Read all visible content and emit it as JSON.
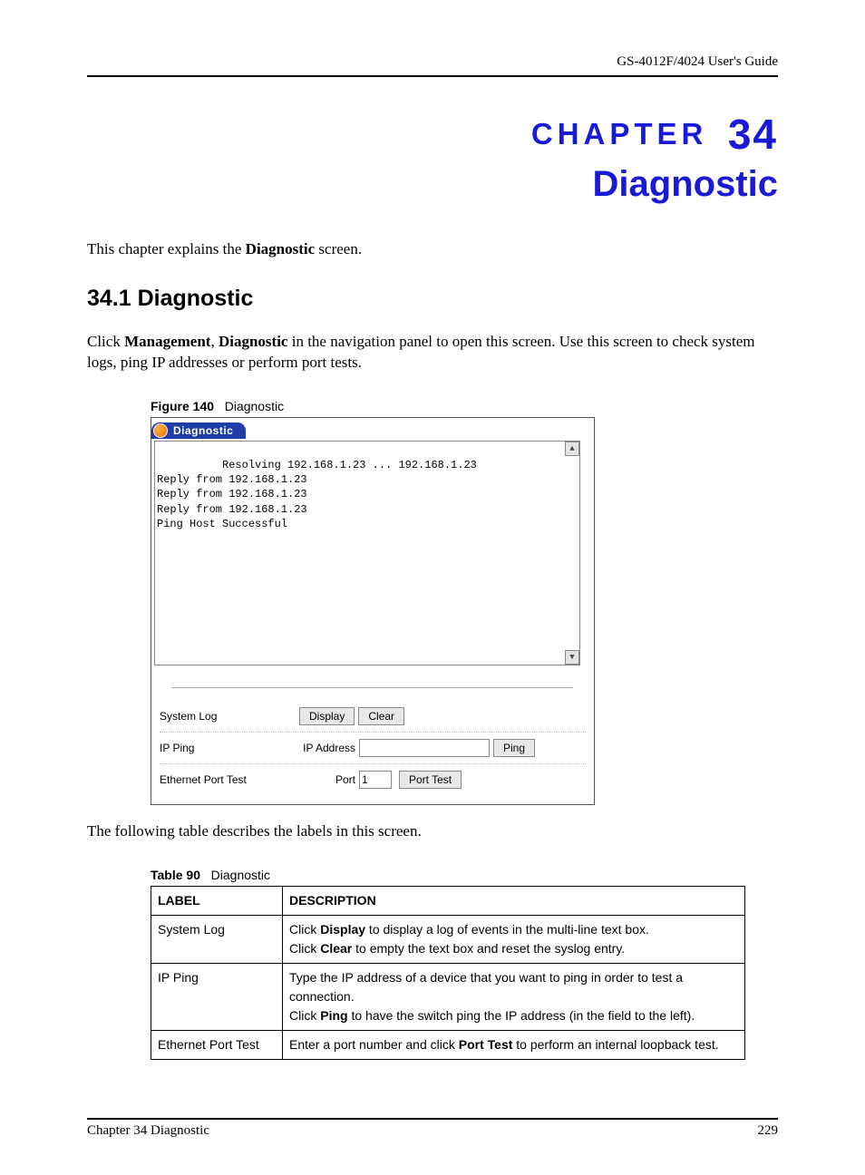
{
  "header": {
    "guide": "GS-4012F/4024 User's Guide"
  },
  "chapter": {
    "word": "CHAPTER",
    "number": "34",
    "title": "Diagnostic",
    "intro_pre": "This chapter explains the ",
    "intro_bold": "Diagnostic",
    "intro_post": " screen."
  },
  "section": {
    "heading": "34.1  Diagnostic",
    "para_pre": "Click ",
    "b1": "Management",
    "sep": ", ",
    "b2": "Diagnostic",
    "para_post": " in the navigation panel to open this screen. Use this screen to check system logs, ping IP addresses or perform port tests."
  },
  "figure": {
    "caption_label": "Figure 140",
    "caption_text": "Diagnostic",
    "tab_label": "Diagnostic",
    "log": "Resolving 192.168.1.23 ... 192.168.1.23\nReply from 192.168.1.23\nReply from 192.168.1.23\nReply from 192.168.1.23\nPing Host Successful",
    "rows": {
      "syslog": {
        "label": "System Log",
        "display": "Display",
        "clear": "Clear"
      },
      "ipping": {
        "label": "IP Ping",
        "sub": "IP Address",
        "value": "",
        "ping": "Ping"
      },
      "porttest": {
        "label": "Ethernet Port Test",
        "sub": "Port",
        "value": "1",
        "btn": "Port Test"
      }
    }
  },
  "after_figure": "The following table describes the labels in this screen.",
  "table": {
    "caption_label": "Table 90",
    "caption_text": "Diagnostic",
    "head": {
      "label": "LABEL",
      "desc": "DESCRIPTION"
    },
    "rows": [
      {
        "label": "System Log",
        "d1_pre": "Click ",
        "d1_b": "Display",
        "d1_post": " to display a log of events in the multi-line text box.",
        "d2_pre": "Click ",
        "d2_b": "Clear",
        "d2_post": " to empty the text box and reset the syslog entry."
      },
      {
        "label": "IP Ping",
        "d1_pre": "Type the IP address of a device that you want to ping in order to test a connection.",
        "d1_b": "",
        "d1_post": "",
        "d2_pre": "Click ",
        "d2_b": "Ping",
        "d2_post": " to have the switch ping the IP address (in the field to the left)."
      },
      {
        "label": "Ethernet Port Test",
        "d1_pre": "Enter a port number and click ",
        "d1_b": "Port Test",
        "d1_post": " to perform an internal loopback test.",
        "d2_pre": "",
        "d2_b": "",
        "d2_post": ""
      }
    ]
  },
  "footer": {
    "left": "Chapter 34 Diagnostic",
    "right": "229"
  }
}
